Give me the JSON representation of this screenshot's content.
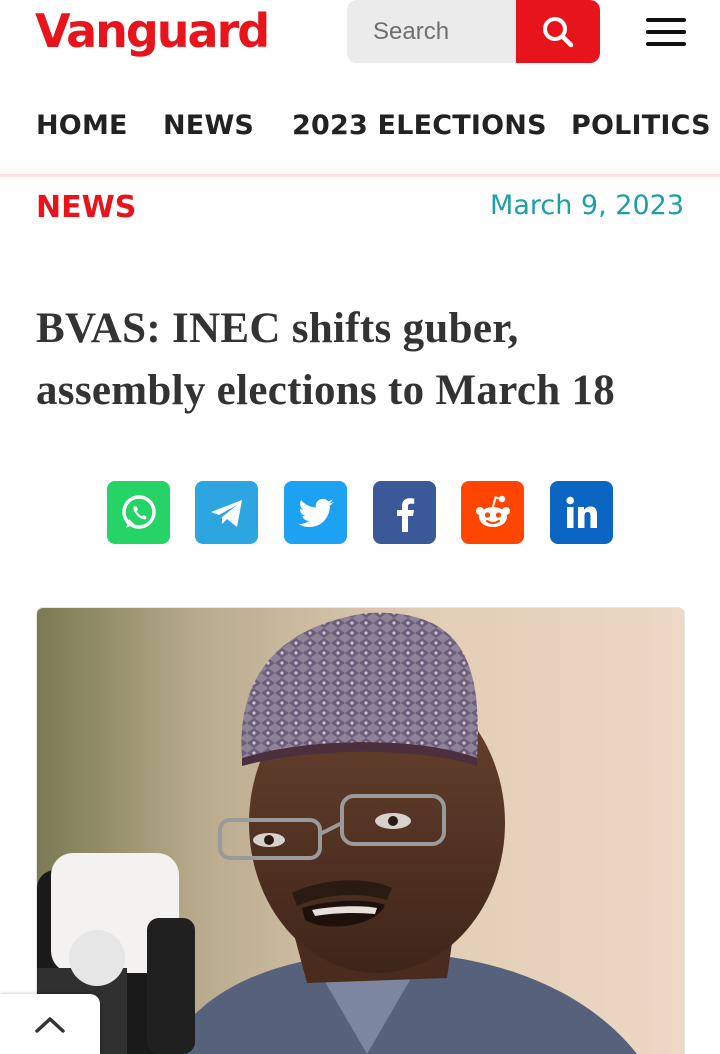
{
  "header": {
    "logo_text": "Vanguard",
    "search_placeholder": "Search",
    "icons": {
      "search": "search-icon",
      "menu": "hamburger-menu-icon"
    }
  },
  "nav": {
    "items": [
      {
        "label": "HOME"
      },
      {
        "label": "NEWS"
      },
      {
        "label": "2023 ELECTIONS"
      },
      {
        "label": "POLITICS"
      }
    ]
  },
  "article": {
    "category": "NEWS",
    "date": "March 9, 2023",
    "headline": "BVAS: INEC shifts guber, assembly elections to March 18",
    "image_icon": "article-photo"
  },
  "share": {
    "buttons": [
      {
        "name": "whatsapp",
        "icon": "whatsapp-icon",
        "color": "#25d366"
      },
      {
        "name": "telegram",
        "icon": "telegram-icon",
        "color": "#2ca5e0"
      },
      {
        "name": "twitter",
        "icon": "twitter-icon",
        "color": "#1da1f2"
      },
      {
        "name": "facebook",
        "icon": "facebook-icon",
        "color": "#3b5998",
        "glyph": "f"
      },
      {
        "name": "reddit",
        "icon": "reddit-icon",
        "color": "#ff4500"
      },
      {
        "name": "linkedin",
        "icon": "linkedin-icon",
        "color": "#0a66c2",
        "glyph": "in"
      }
    ]
  },
  "colors": {
    "brand_red": "#e8141c",
    "date_teal": "#1aa0a6",
    "headline": "#333333"
  },
  "scroll_top": {
    "icon": "chevron-up-icon"
  }
}
